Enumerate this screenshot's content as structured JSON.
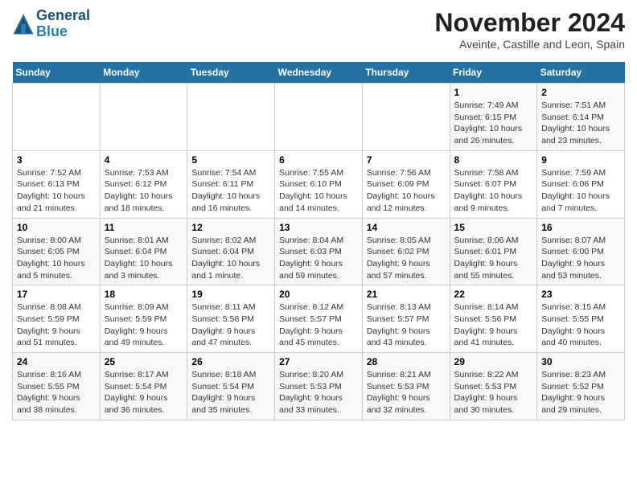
{
  "logo": {
    "line1": "General",
    "line2": "Blue"
  },
  "title": "November 2024",
  "subtitle": "Aveinte, Castille and Leon, Spain",
  "days_of_week": [
    "Sunday",
    "Monday",
    "Tuesday",
    "Wednesday",
    "Thursday",
    "Friday",
    "Saturday"
  ],
  "weeks": [
    [
      {
        "day": "",
        "info": ""
      },
      {
        "day": "",
        "info": ""
      },
      {
        "day": "",
        "info": ""
      },
      {
        "day": "",
        "info": ""
      },
      {
        "day": "",
        "info": ""
      },
      {
        "day": "1",
        "info": "Sunrise: 7:49 AM\nSunset: 6:15 PM\nDaylight: 10 hours and 26 minutes."
      },
      {
        "day": "2",
        "info": "Sunrise: 7:51 AM\nSunset: 6:14 PM\nDaylight: 10 hours and 23 minutes."
      }
    ],
    [
      {
        "day": "3",
        "info": "Sunrise: 7:52 AM\nSunset: 6:13 PM\nDaylight: 10 hours and 21 minutes."
      },
      {
        "day": "4",
        "info": "Sunrise: 7:53 AM\nSunset: 6:12 PM\nDaylight: 10 hours and 18 minutes."
      },
      {
        "day": "5",
        "info": "Sunrise: 7:54 AM\nSunset: 6:11 PM\nDaylight: 10 hours and 16 minutes."
      },
      {
        "day": "6",
        "info": "Sunrise: 7:55 AM\nSunset: 6:10 PM\nDaylight: 10 hours and 14 minutes."
      },
      {
        "day": "7",
        "info": "Sunrise: 7:56 AM\nSunset: 6:09 PM\nDaylight: 10 hours and 12 minutes."
      },
      {
        "day": "8",
        "info": "Sunrise: 7:58 AM\nSunset: 6:07 PM\nDaylight: 10 hours and 9 minutes."
      },
      {
        "day": "9",
        "info": "Sunrise: 7:59 AM\nSunset: 6:06 PM\nDaylight: 10 hours and 7 minutes."
      }
    ],
    [
      {
        "day": "10",
        "info": "Sunrise: 8:00 AM\nSunset: 6:05 PM\nDaylight: 10 hours and 5 minutes."
      },
      {
        "day": "11",
        "info": "Sunrise: 8:01 AM\nSunset: 6:04 PM\nDaylight: 10 hours and 3 minutes."
      },
      {
        "day": "12",
        "info": "Sunrise: 8:02 AM\nSunset: 6:04 PM\nDaylight: 10 hours and 1 minute."
      },
      {
        "day": "13",
        "info": "Sunrise: 8:04 AM\nSunset: 6:03 PM\nDaylight: 9 hours and 59 minutes."
      },
      {
        "day": "14",
        "info": "Sunrise: 8:05 AM\nSunset: 6:02 PM\nDaylight: 9 hours and 57 minutes."
      },
      {
        "day": "15",
        "info": "Sunrise: 8:06 AM\nSunset: 6:01 PM\nDaylight: 9 hours and 55 minutes."
      },
      {
        "day": "16",
        "info": "Sunrise: 8:07 AM\nSunset: 6:00 PM\nDaylight: 9 hours and 53 minutes."
      }
    ],
    [
      {
        "day": "17",
        "info": "Sunrise: 8:08 AM\nSunset: 5:59 PM\nDaylight: 9 hours and 51 minutes."
      },
      {
        "day": "18",
        "info": "Sunrise: 8:09 AM\nSunset: 5:59 PM\nDaylight: 9 hours and 49 minutes."
      },
      {
        "day": "19",
        "info": "Sunrise: 8:11 AM\nSunset: 5:58 PM\nDaylight: 9 hours and 47 minutes."
      },
      {
        "day": "20",
        "info": "Sunrise: 8:12 AM\nSunset: 5:57 PM\nDaylight: 9 hours and 45 minutes."
      },
      {
        "day": "21",
        "info": "Sunrise: 8:13 AM\nSunset: 5:57 PM\nDaylight: 9 hours and 43 minutes."
      },
      {
        "day": "22",
        "info": "Sunrise: 8:14 AM\nSunset: 5:56 PM\nDaylight: 9 hours and 41 minutes."
      },
      {
        "day": "23",
        "info": "Sunrise: 8:15 AM\nSunset: 5:55 PM\nDaylight: 9 hours and 40 minutes."
      }
    ],
    [
      {
        "day": "24",
        "info": "Sunrise: 8:16 AM\nSunset: 5:55 PM\nDaylight: 9 hours and 38 minutes."
      },
      {
        "day": "25",
        "info": "Sunrise: 8:17 AM\nSunset: 5:54 PM\nDaylight: 9 hours and 36 minutes."
      },
      {
        "day": "26",
        "info": "Sunrise: 8:18 AM\nSunset: 5:54 PM\nDaylight: 9 hours and 35 minutes."
      },
      {
        "day": "27",
        "info": "Sunrise: 8:20 AM\nSunset: 5:53 PM\nDaylight: 9 hours and 33 minutes."
      },
      {
        "day": "28",
        "info": "Sunrise: 8:21 AM\nSunset: 5:53 PM\nDaylight: 9 hours and 32 minutes."
      },
      {
        "day": "29",
        "info": "Sunrise: 8:22 AM\nSunset: 5:53 PM\nDaylight: 9 hours and 30 minutes."
      },
      {
        "day": "30",
        "info": "Sunrise: 8:23 AM\nSunset: 5:52 PM\nDaylight: 9 hours and 29 minutes."
      }
    ]
  ]
}
